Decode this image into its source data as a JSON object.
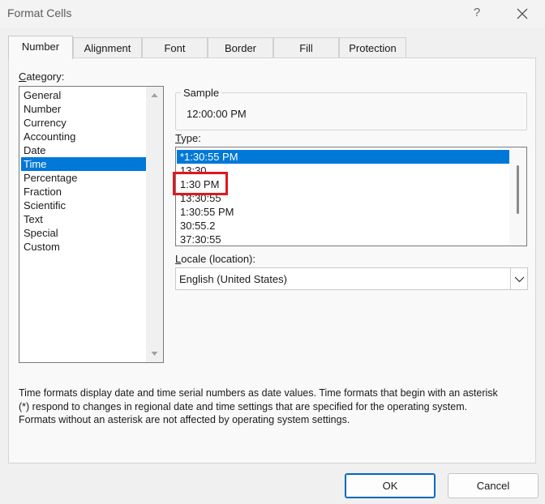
{
  "window": {
    "title": "Format Cells",
    "help_label": "?"
  },
  "tabs": [
    {
      "label": "Number",
      "active": true
    },
    {
      "label": "Alignment",
      "active": false
    },
    {
      "label": "Font",
      "active": false
    },
    {
      "label": "Border",
      "active": false
    },
    {
      "label": "Fill",
      "active": false
    },
    {
      "label": "Protection",
      "active": false
    }
  ],
  "category": {
    "label_accel": "C",
    "label_rest": "ategory:",
    "items": [
      "General",
      "Number",
      "Currency",
      "Accounting",
      "Date",
      "Time",
      "Percentage",
      "Fraction",
      "Scientific",
      "Text",
      "Special",
      "Custom"
    ],
    "selected": "Time"
  },
  "sample": {
    "caption": "Sample",
    "value": "12:00:00 PM"
  },
  "type": {
    "label_accel": "T",
    "label_rest": "ype:",
    "items": [
      "*1:30:55 PM",
      "13:30",
      "1:30 PM",
      "13:30:55",
      "1:30:55 PM",
      "30:55.2",
      "37:30:55"
    ],
    "selected": "*1:30:55 PM",
    "highlighted": "1:30 PM"
  },
  "locale": {
    "label_accel": "L",
    "label_rest": "ocale (location):",
    "value": "English (United States)"
  },
  "description": {
    "line1": "Time formats display date and time serial numbers as date values.  Time formats that begin with an asterisk",
    "line2": "(*) respond to changes in regional date and time settings that are specified for the operating system.",
    "line3": "Formats without an asterisk are not affected by operating system settings."
  },
  "buttons": {
    "ok": "OK",
    "cancel": "Cancel"
  },
  "colors": {
    "selection": "#0078d7",
    "highlight_border": "#e0171f",
    "ok_border": "#0067c0"
  },
  "icons": {
    "close": "close-icon",
    "scroll_up": "chevron-up-icon",
    "scroll_down": "chevron-down-icon",
    "dropdown": "chevron-down-icon"
  }
}
